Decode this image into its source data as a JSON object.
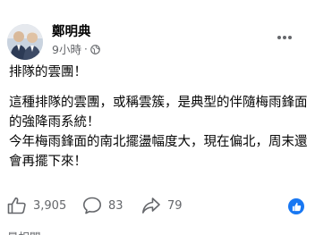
{
  "post": {
    "author": "鄭明典",
    "timestamp": "9小時",
    "separator": "·",
    "privacy_icon": "globe-icon",
    "more_icon": "more-options-icon",
    "paragraphs": [
      "排隊的雲團！",
      "這種排隊的雲團，或稱雲簇，是典型的伴隨梅雨鋒面的強降雨系統！\n今年梅雨鋒面的南北擺盪幅度大，現在偏北，周末還會再擺下來！"
    ]
  },
  "stats": {
    "like_count": "3,905",
    "comment_count": "83",
    "share_count": "79"
  },
  "footer": {
    "partial_text": "最相關"
  },
  "colors": {
    "text": "#050505",
    "secondary": "#65676b",
    "accent": "#1877f2"
  }
}
